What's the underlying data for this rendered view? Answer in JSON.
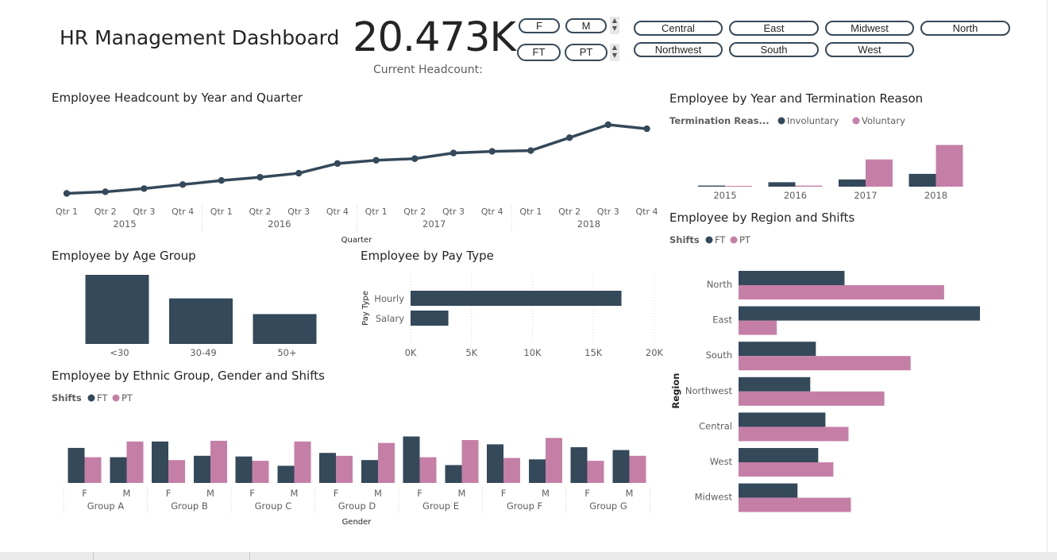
{
  "dashboard": {
    "title": "HR Management Dashboard"
  },
  "kpi": {
    "value": "20.473K",
    "label": "Current Headcount:"
  },
  "slicers": {
    "gender": [
      "F",
      "M"
    ],
    "shift": [
      "FT",
      "PT"
    ],
    "region": [
      "Central",
      "East",
      "Midwest",
      "North",
      "Northwest",
      "South",
      "West"
    ]
  },
  "colors": {
    "ft": "#34495a",
    "pt": "#c57fa7",
    "line": "#34495a",
    "axis_text": "#605e5c"
  },
  "chart_data": [
    {
      "id": "headcount_line",
      "type": "line",
      "title": "Employee Headcount by Year and Quarter",
      "xlabel": "Quarter",
      "x_quarters": [
        "Qtr 1",
        "Qtr 2",
        "Qtr 3",
        "Qtr 4",
        "Qtr 1",
        "Qtr 2",
        "Qtr 3",
        "Qtr 4",
        "Qtr 1",
        "Qtr 2",
        "Qtr 3",
        "Qtr 4",
        "Qtr 1",
        "Qtr 2",
        "Qtr 3",
        "Qtr 4"
      ],
      "x_years": [
        "2015",
        "2016",
        "2017",
        "2018"
      ],
      "values": [
        1.0,
        1.2,
        1.6,
        2.1,
        2.6,
        3.0,
        3.5,
        4.7,
        5.1,
        5.3,
        6.0,
        6.2,
        6.3,
        7.9,
        9.5,
        9.0
      ],
      "ylim": [
        0,
        10
      ],
      "grid": false
    },
    {
      "id": "termination",
      "type": "bar",
      "title": "Employee by Year and Termination Reason",
      "legend_title": "Termination Reas...",
      "categories": [
        "2015",
        "2016",
        "2017",
        "2018"
      ],
      "series": [
        {
          "name": "Involuntary",
          "values": [
            2,
            8,
            13,
            23
          ]
        },
        {
          "name": "Voluntary",
          "values": [
            0,
            2,
            49,
            75
          ]
        }
      ],
      "ylim": [
        0,
        80
      ]
    },
    {
      "id": "age_group",
      "type": "bar",
      "title": "Employee by Age Group",
      "categories": [
        "<30",
        "30-49",
        "50+"
      ],
      "values": [
        8800,
        5800,
        3800
      ],
      "ylim": [
        0,
        8800
      ]
    },
    {
      "id": "pay_type",
      "type": "bar",
      "orientation": "horizontal",
      "title": "Employee by Pay Type",
      "ylabel": "Pay Type",
      "categories": [
        "Hourly",
        "Salary"
      ],
      "values": [
        17300,
        3100
      ],
      "xlim": [
        0,
        20000
      ],
      "ticks": [
        "0K",
        "5K",
        "10K",
        "15K",
        "20K"
      ],
      "grid": true
    },
    {
      "id": "ethnic",
      "type": "bar",
      "title": "Employee by Ethnic Group, Gender and Shifts",
      "legend_title": "Shifts",
      "xlabel": "Gender",
      "groups": [
        "Group A",
        "Group B",
        "Group C",
        "Group D",
        "Group E",
        "Group F",
        "Group G"
      ],
      "genders": [
        "F",
        "M"
      ],
      "series": [
        {
          "name": "FT",
          "values": [
            49,
            36,
            58,
            38,
            37,
            24,
            42,
            32,
            65,
            25,
            54,
            33,
            50,
            46
          ]
        },
        {
          "name": "PT",
          "values": [
            36,
            58,
            32,
            59,
            31,
            58,
            38,
            56,
            36,
            60,
            35,
            63,
            31,
            38
          ]
        }
      ],
      "ylim": [
        0,
        70
      ]
    },
    {
      "id": "region_shifts",
      "type": "bar",
      "orientation": "horizontal",
      "title": "Employee by Region and Shifts",
      "legend_title": "Shifts",
      "ylabel": "Region",
      "categories": [
        "North",
        "East",
        "South",
        "Northwest",
        "Central",
        "West",
        "Midwest"
      ],
      "series": [
        {
          "name": "FT",
          "values": [
            1330,
            3030,
            970,
            900,
            1090,
            1000,
            740
          ]
        },
        {
          "name": "PT",
          "values": [
            2580,
            480,
            2160,
            1830,
            1380,
            1190,
            1410
          ]
        }
      ],
      "xlim": [
        0,
        3030
      ]
    }
  ]
}
